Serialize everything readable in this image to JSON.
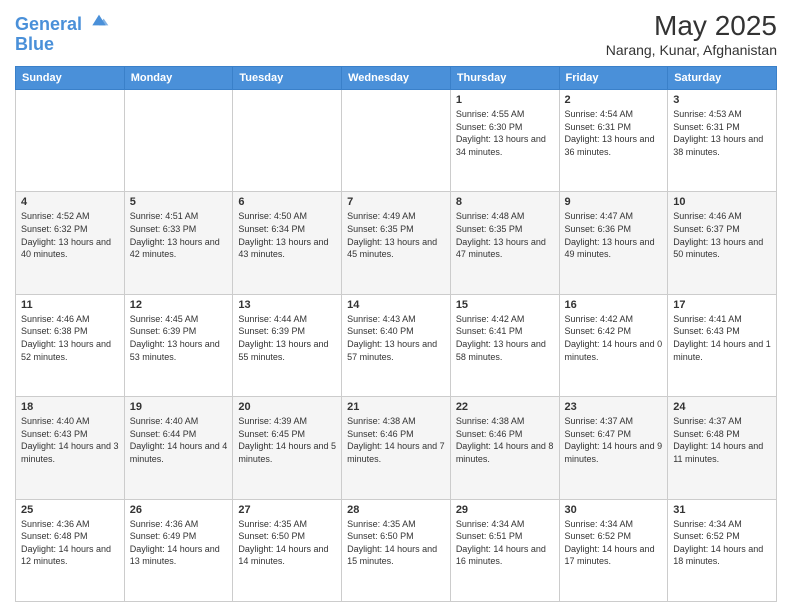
{
  "logo": {
    "line1": "General",
    "line2": "Blue"
  },
  "title": "May 2025",
  "subtitle": "Narang, Kunar, Afghanistan",
  "days_of_week": [
    "Sunday",
    "Monday",
    "Tuesday",
    "Wednesday",
    "Thursday",
    "Friday",
    "Saturday"
  ],
  "weeks": [
    [
      {
        "day": "",
        "sunrise": "",
        "sunset": "",
        "daylight": ""
      },
      {
        "day": "",
        "sunrise": "",
        "sunset": "",
        "daylight": ""
      },
      {
        "day": "",
        "sunrise": "",
        "sunset": "",
        "daylight": ""
      },
      {
        "day": "",
        "sunrise": "",
        "sunset": "",
        "daylight": ""
      },
      {
        "day": "1",
        "sunrise": "4:55 AM",
        "sunset": "6:30 PM",
        "daylight": "13 hours and 34 minutes."
      },
      {
        "day": "2",
        "sunrise": "4:54 AM",
        "sunset": "6:31 PM",
        "daylight": "13 hours and 36 minutes."
      },
      {
        "day": "3",
        "sunrise": "4:53 AM",
        "sunset": "6:31 PM",
        "daylight": "13 hours and 38 minutes."
      }
    ],
    [
      {
        "day": "4",
        "sunrise": "4:52 AM",
        "sunset": "6:32 PM",
        "daylight": "13 hours and 40 minutes."
      },
      {
        "day": "5",
        "sunrise": "4:51 AM",
        "sunset": "6:33 PM",
        "daylight": "13 hours and 42 minutes."
      },
      {
        "day": "6",
        "sunrise": "4:50 AM",
        "sunset": "6:34 PM",
        "daylight": "13 hours and 43 minutes."
      },
      {
        "day": "7",
        "sunrise": "4:49 AM",
        "sunset": "6:35 PM",
        "daylight": "13 hours and 45 minutes."
      },
      {
        "day": "8",
        "sunrise": "4:48 AM",
        "sunset": "6:35 PM",
        "daylight": "13 hours and 47 minutes."
      },
      {
        "day": "9",
        "sunrise": "4:47 AM",
        "sunset": "6:36 PM",
        "daylight": "13 hours and 49 minutes."
      },
      {
        "day": "10",
        "sunrise": "4:46 AM",
        "sunset": "6:37 PM",
        "daylight": "13 hours and 50 minutes."
      }
    ],
    [
      {
        "day": "11",
        "sunrise": "4:46 AM",
        "sunset": "6:38 PM",
        "daylight": "13 hours and 52 minutes."
      },
      {
        "day": "12",
        "sunrise": "4:45 AM",
        "sunset": "6:39 PM",
        "daylight": "13 hours and 53 minutes."
      },
      {
        "day": "13",
        "sunrise": "4:44 AM",
        "sunset": "6:39 PM",
        "daylight": "13 hours and 55 minutes."
      },
      {
        "day": "14",
        "sunrise": "4:43 AM",
        "sunset": "6:40 PM",
        "daylight": "13 hours and 57 minutes."
      },
      {
        "day": "15",
        "sunrise": "4:42 AM",
        "sunset": "6:41 PM",
        "daylight": "13 hours and 58 minutes."
      },
      {
        "day": "16",
        "sunrise": "4:42 AM",
        "sunset": "6:42 PM",
        "daylight": "14 hours and 0 minutes."
      },
      {
        "day": "17",
        "sunrise": "4:41 AM",
        "sunset": "6:43 PM",
        "daylight": "14 hours and 1 minute."
      }
    ],
    [
      {
        "day": "18",
        "sunrise": "4:40 AM",
        "sunset": "6:43 PM",
        "daylight": "14 hours and 3 minutes."
      },
      {
        "day": "19",
        "sunrise": "4:40 AM",
        "sunset": "6:44 PM",
        "daylight": "14 hours and 4 minutes."
      },
      {
        "day": "20",
        "sunrise": "4:39 AM",
        "sunset": "6:45 PM",
        "daylight": "14 hours and 5 minutes."
      },
      {
        "day": "21",
        "sunrise": "4:38 AM",
        "sunset": "6:46 PM",
        "daylight": "14 hours and 7 minutes."
      },
      {
        "day": "22",
        "sunrise": "4:38 AM",
        "sunset": "6:46 PM",
        "daylight": "14 hours and 8 minutes."
      },
      {
        "day": "23",
        "sunrise": "4:37 AM",
        "sunset": "6:47 PM",
        "daylight": "14 hours and 9 minutes."
      },
      {
        "day": "24",
        "sunrise": "4:37 AM",
        "sunset": "6:48 PM",
        "daylight": "14 hours and 11 minutes."
      }
    ],
    [
      {
        "day": "25",
        "sunrise": "4:36 AM",
        "sunset": "6:48 PM",
        "daylight": "14 hours and 12 minutes."
      },
      {
        "day": "26",
        "sunrise": "4:36 AM",
        "sunset": "6:49 PM",
        "daylight": "14 hours and 13 minutes."
      },
      {
        "day": "27",
        "sunrise": "4:35 AM",
        "sunset": "6:50 PM",
        "daylight": "14 hours and 14 minutes."
      },
      {
        "day": "28",
        "sunrise": "4:35 AM",
        "sunset": "6:50 PM",
        "daylight": "14 hours and 15 minutes."
      },
      {
        "day": "29",
        "sunrise": "4:34 AM",
        "sunset": "6:51 PM",
        "daylight": "14 hours and 16 minutes."
      },
      {
        "day": "30",
        "sunrise": "4:34 AM",
        "sunset": "6:52 PM",
        "daylight": "14 hours and 17 minutes."
      },
      {
        "day": "31",
        "sunrise": "4:34 AM",
        "sunset": "6:52 PM",
        "daylight": "14 hours and 18 minutes."
      }
    ]
  ]
}
